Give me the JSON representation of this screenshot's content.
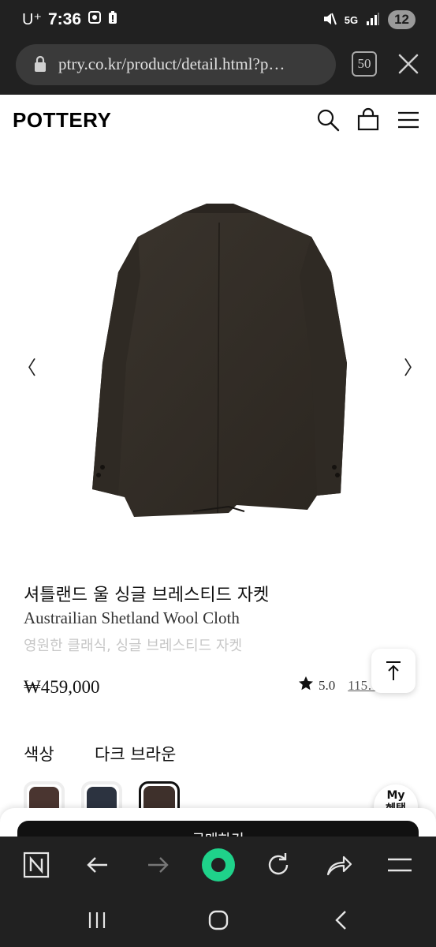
{
  "status_bar": {
    "carrier": "U⁺",
    "time": "7:36",
    "network": "5G",
    "battery": "12"
  },
  "browser": {
    "url": "ptry.co.kr/product/detail.html?p…",
    "tab_count": "50"
  },
  "site": {
    "logo": "POTTERY"
  },
  "product": {
    "title_ko": "셔틀랜드 울 싱글 브레스티드 자켓",
    "title_en": "Austrailian Shetland Wool Cloth",
    "subtitle": "영원한 클래식, 싱글 브레스티드 자켓",
    "price": "₩459,000",
    "rating": "5.0",
    "reviews": "115…"
  },
  "options": {
    "color_label": "색상",
    "selected_color": "다크 브라운",
    "swatches": [
      {
        "name": "brown",
        "color": "#4a3530"
      },
      {
        "name": "navy",
        "color": "#2c3340"
      },
      {
        "name": "dark-brown",
        "color": "#3e302b"
      }
    ]
  },
  "floating": {
    "my_benefit_line1": "My",
    "my_benefit_line2": "혜택"
  },
  "buy_button": {
    "label": "구매하기"
  },
  "colors": {
    "dark_bg": "#212121",
    "accent_green": "#1fd28a"
  }
}
